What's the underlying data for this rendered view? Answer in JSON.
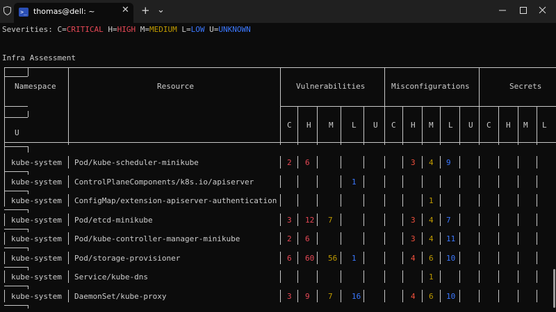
{
  "window": {
    "tab_title": "thomas@dell: ~",
    "tab_close": "✕",
    "new_tab": "+",
    "dropdown": "⌄"
  },
  "severities": {
    "prefix": "Severities: ",
    "items": [
      {
        "key": "C=",
        "label": "CRITICAL",
        "color": "#e74856"
      },
      {
        "key": " H=",
        "label": "HIGH",
        "color": "#e74856"
      },
      {
        "key": " M=",
        "label": "MEDIUM",
        "color": "#c19c00"
      },
      {
        "key": " L=",
        "label": "LOW",
        "color": "#3b78ff"
      },
      {
        "key": " U=",
        "label": "UNKNOWN",
        "color": "#3b78ff"
      }
    ]
  },
  "section_title": "Infra Assessment",
  "headers": {
    "namespace": "Namespace",
    "resource": "Resource",
    "vulnerabilities": "Vulnerabilities",
    "misconfigurations": "Misconfigurations",
    "secrets": "Secrets",
    "u_col": "U",
    "sev_cols": [
      "C",
      "H",
      "M",
      "L",
      "U",
      "C",
      "H",
      "M",
      "L",
      "U",
      "C",
      "H",
      "M",
      "L"
    ]
  },
  "rows": [
    {
      "namespace": "kube-system",
      "resource": "Pod/kube-scheduler-minikube",
      "vuln": [
        "2",
        "6",
        "",
        "",
        ""
      ],
      "mis": [
        "",
        "3",
        "4",
        "9",
        ""
      ]
    },
    {
      "namespace": "kube-system",
      "resource": "ControlPlaneComponents/k8s.io/apiserver",
      "vuln": [
        "",
        "",
        "",
        "1",
        ""
      ],
      "mis": [
        "",
        "",
        "",
        "",
        ""
      ]
    },
    {
      "namespace": "kube-system",
      "resource": "ConfigMap/extension-apiserver-authentication",
      "vuln": [
        "",
        "",
        "",
        "",
        ""
      ],
      "mis": [
        "",
        "",
        "1",
        "",
        ""
      ]
    },
    {
      "namespace": "kube-system",
      "resource": "Pod/etcd-minikube",
      "vuln": [
        "3",
        "12",
        "7",
        "",
        ""
      ],
      "mis": [
        "",
        "3",
        "4",
        "7",
        ""
      ]
    },
    {
      "namespace": "kube-system",
      "resource": "Pod/kube-controller-manager-minikube",
      "vuln": [
        "2",
        "6",
        "",
        "",
        ""
      ],
      "mis": [
        "",
        "3",
        "4",
        "11",
        ""
      ]
    },
    {
      "namespace": "kube-system",
      "resource": "Pod/storage-provisioner",
      "vuln": [
        "6",
        "60",
        "56",
        "1",
        ""
      ],
      "mis": [
        "",
        "4",
        "6",
        "10",
        ""
      ]
    },
    {
      "namespace": "kube-system",
      "resource": "Service/kube-dns",
      "vuln": [
        "",
        "",
        "",
        "",
        ""
      ],
      "mis": [
        "",
        "",
        "1",
        "",
        ""
      ]
    },
    {
      "namespace": "kube-system",
      "resource": "DaemonSet/kube-proxy",
      "vuln": [
        "3",
        "9",
        "7",
        "16",
        ""
      ],
      "mis": [
        "",
        "4",
        "6",
        "10",
        ""
      ]
    }
  ]
}
